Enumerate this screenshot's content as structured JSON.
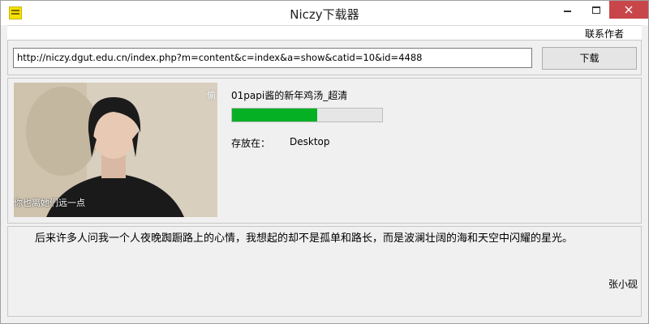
{
  "window": {
    "title": "Niczy下载器"
  },
  "menu": {
    "contact_author": "联系作者"
  },
  "url_bar": {
    "value": "http://niczy.dgut.edu.cn/index.php?m=content&c=index&a=show&catid=10&id=4488",
    "download_label": "下载"
  },
  "video": {
    "title": "01papi酱的新年鸡汤_超清",
    "thumbnail_caption": "你也离她们远一点",
    "thumbnail_watermark": "偷",
    "progress_percent": 57,
    "progress_color": "#06b025",
    "save_label": "存放在：",
    "save_location": "Desktop"
  },
  "quote": {
    "text": "后来许多人问我一个人夜晚踟蹰路上的心情，我想起的却不是孤单和路长，而是波澜壮阔的海和天空中闪耀的星光。",
    "author": "张小砚"
  }
}
